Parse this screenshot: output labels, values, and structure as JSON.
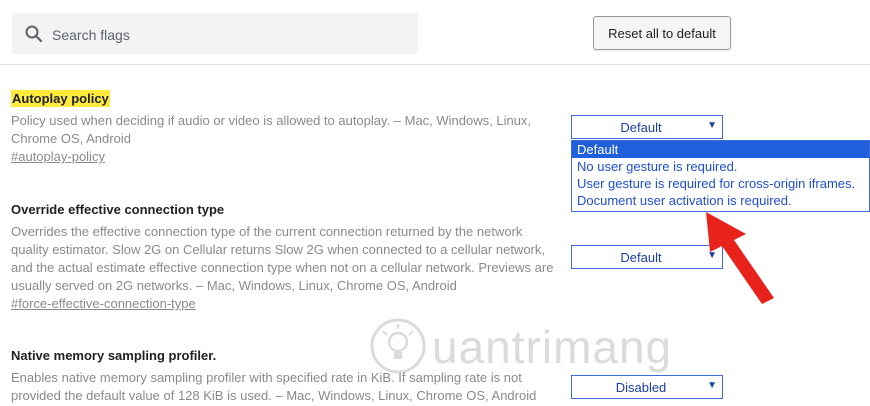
{
  "search": {
    "placeholder": "Search flags",
    "icon": "search-icon"
  },
  "header": {
    "reset_label": "Reset all to default"
  },
  "flags": [
    {
      "title": "Autoplay policy",
      "description": "Policy used when deciding if audio or video is allowed to autoplay. – Mac, Windows, Linux, Chrome OS, Android",
      "link": "#autoplay-policy",
      "selected": "Default"
    },
    {
      "title": "Override effective connection type",
      "description": "Overrides the effective connection type of the current connection returned by the network quality estimator. Slow 2G on Cellular returns Slow 2G when connected to a cellular network, and the actual estimate effective connection type when not on a cellular network. Previews are usually served on 2G networks. – Mac, Windows, Linux, Chrome OS, Android",
      "link": "#force-effective-connection-type",
      "selected": "Default"
    },
    {
      "title": "Native memory sampling profiler.",
      "description": "Enables native memory sampling profiler with specified rate in KiB. If sampling rate is not provided the default value of 128 KiB is used. – Mac, Windows, Linux, Chrome OS, Android",
      "selected": "Disabled"
    }
  ],
  "dropdown": {
    "options": [
      "Default",
      "No user gesture is required.",
      "User gesture is required for cross-origin iframes.",
      "Document user activation is required."
    ],
    "selected_index": 0
  },
  "watermark": {
    "text": "uantrimang"
  },
  "colors": {
    "highlight": "#ffeb3b",
    "select_border": "#3d6bd8",
    "option_selected_bg": "#1f5fdc",
    "arrow": "#e8231b"
  }
}
